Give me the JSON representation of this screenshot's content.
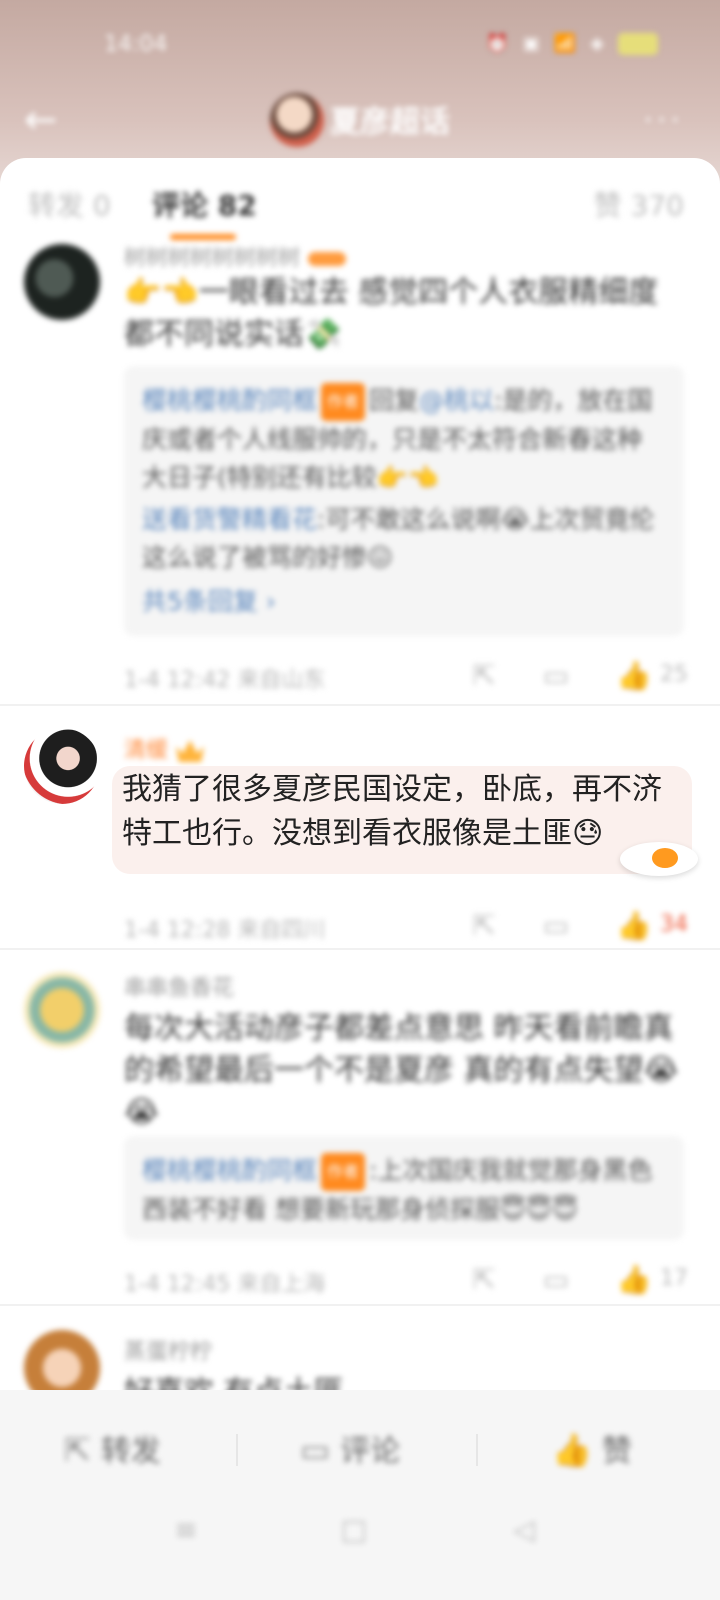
{
  "status_bar": {
    "time": "14:04"
  },
  "header": {
    "title": "夏彦超话",
    "more": "···"
  },
  "tabs": {
    "repost": "转发 0",
    "comments": "评论 82",
    "likes": "赞 370"
  },
  "comments": [
    {
      "username": "树树树树树树树树",
      "text": "👉👈一眼看过去 感觉四个人衣服精细度都不同说实话💸",
      "replies": [
        {
          "name": "樱桃樱桃酌同框",
          "tag": "作者",
          "body_prefix": "回复",
          "mention": "@桃以",
          "body": ":是的，放在国庆或者个人线服帅的，只是不太符合新春这种大日子(特别还有比较👉👈"
        },
        {
          "name": "送看货警精看花",
          "body": ":可不敢这么说啊😭上次贸竟伦这么说了被骂的好惨😖"
        }
      ],
      "more_replies": "共5条回复",
      "time": "1-4 12:42 来自山东",
      "likes": "25"
    },
    {
      "username": "清缓",
      "text": "我猜了很多夏彦民国设定，卧底，再不济特工也行。没想到看衣服像是土匪😓",
      "time": "1-4 12:28 来自四川",
      "likes": "34"
    },
    {
      "username": "串串鱼香花",
      "text": "每次大活动彦子都差点意思 昨天看前瞻真的希望最后一个不是夏彦 真的有点失望😭😭",
      "replies": [
        {
          "name": "樱桃樱桃酌同框",
          "tag": "作者",
          "body": ":上次国庆我就觉那身黑色西装不好看 想要新玩那身侦探服😇😇😇"
        }
      ],
      "time": "1-4 12:45 来自上海",
      "likes": "17"
    },
    {
      "username": "蒸蛋柠柠",
      "text": "好喜欢 有点土匪……"
    }
  ],
  "bottom_bar": {
    "repost": "转发",
    "comment": "评论",
    "like": "赞"
  },
  "icons": {
    "back": "arrow-left-icon",
    "share": "share-icon",
    "reply": "comment-icon",
    "like": "thumbs-up-icon",
    "menu": "menu-icon",
    "home": "home-icon",
    "back_nav": "triangle-back-icon"
  },
  "colors": {
    "accent": "#ff8a1f",
    "link": "#5a86bd",
    "liked": "#ee5a3a"
  }
}
